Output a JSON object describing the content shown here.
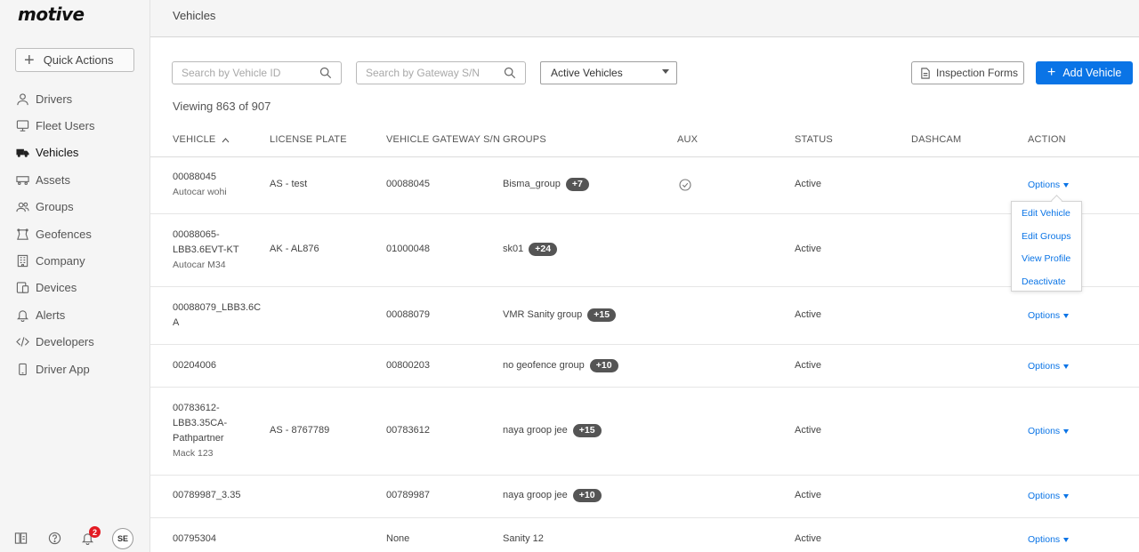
{
  "app": {
    "logo": "motive"
  },
  "sidebar": {
    "quick_actions": "Quick Actions",
    "items": [
      {
        "label": "Drivers",
        "icon": "person-icon"
      },
      {
        "label": "Fleet Users",
        "icon": "monitor-icon"
      },
      {
        "label": "Vehicles",
        "icon": "truck-icon",
        "active": true
      },
      {
        "label": "Assets",
        "icon": "trailer-icon"
      },
      {
        "label": "Groups",
        "icon": "group-icon"
      },
      {
        "label": "Geofences",
        "icon": "geofence-icon"
      },
      {
        "label": "Company",
        "icon": "building-icon"
      },
      {
        "label": "Devices",
        "icon": "devices-icon"
      },
      {
        "label": "Alerts",
        "icon": "bell-icon"
      },
      {
        "label": "Developers",
        "icon": "code-icon"
      },
      {
        "label": "Driver App",
        "icon": "phone-icon"
      }
    ],
    "notifications_count": "2",
    "avatar_initials": "SE"
  },
  "header": {
    "title": "Vehicles"
  },
  "filters": {
    "vehicle_search_placeholder": "Search by Vehicle ID",
    "gateway_search_placeholder": "Search by Gateway S/N",
    "status_select": "Active Vehicles",
    "inspection_forms": "Inspection Forms",
    "add_vehicle": "Add Vehicle"
  },
  "viewing": "Viewing 863 of 907",
  "table": {
    "headers": {
      "vehicle": "VEHICLE",
      "sort_arrow": "^",
      "license_plate": "LICENSE PLATE",
      "gateway": "VEHICLE GATEWAY S/N",
      "groups": "GROUPS",
      "aux": "AUX",
      "status": "STATUS",
      "dashcam": "DASHCAM",
      "action": "ACTION"
    },
    "options_label": "Options",
    "rows": [
      {
        "vehicle_lines": [
          "00088045"
        ],
        "subtitle": "Autocar wohi",
        "plate": "AS - test",
        "gateway": "00088045",
        "group": "Bisma_group",
        "extra": "+7",
        "aux": true,
        "status": "Active"
      },
      {
        "vehicle_lines": [
          "00088065-",
          "LBB3.6EVT-KT"
        ],
        "subtitle": "Autocar M34",
        "plate": "AK - AL876",
        "gateway": "01000048",
        "group": "sk01",
        "extra": "+24",
        "aux": false,
        "status": "Active"
      },
      {
        "vehicle_lines": [
          "00088079_LBB3.6C",
          "A"
        ],
        "subtitle": "",
        "plate": "",
        "gateway": "00088079",
        "group": "VMR Sanity group",
        "extra": "+15",
        "aux": false,
        "status": "Active"
      },
      {
        "vehicle_lines": [
          "00204006"
        ],
        "subtitle": "",
        "plate": "",
        "gateway": "00800203",
        "group": "no geofence group",
        "extra": "+10",
        "aux": false,
        "status": "Active"
      },
      {
        "vehicle_lines": [
          "00783612-",
          "LBB3.35CA-",
          "Pathpartner"
        ],
        "subtitle": "Mack 123",
        "plate": "AS - 8767789",
        "gateway": "00783612",
        "group": "naya groop jee",
        "extra": "+15",
        "aux": false,
        "status": "Active"
      },
      {
        "vehicle_lines": [
          "00789987_3.35"
        ],
        "subtitle": "",
        "plate": "",
        "gateway": "00789987",
        "group": "naya groop jee",
        "extra": "+10",
        "aux": false,
        "status": "Active"
      },
      {
        "vehicle_lines": [
          "00795304"
        ],
        "subtitle": "",
        "plate": "",
        "gateway": "None",
        "group": "Sanity 12",
        "extra": "",
        "aux": false,
        "status": "Active"
      }
    ]
  },
  "options_menu": {
    "items": [
      "Edit Vehicle",
      "Edit Groups",
      "View Profile",
      "Deactivate"
    ]
  },
  "colors": {
    "accent": "#0a74e6",
    "badge": "#e31b23",
    "tag": "#555555"
  }
}
